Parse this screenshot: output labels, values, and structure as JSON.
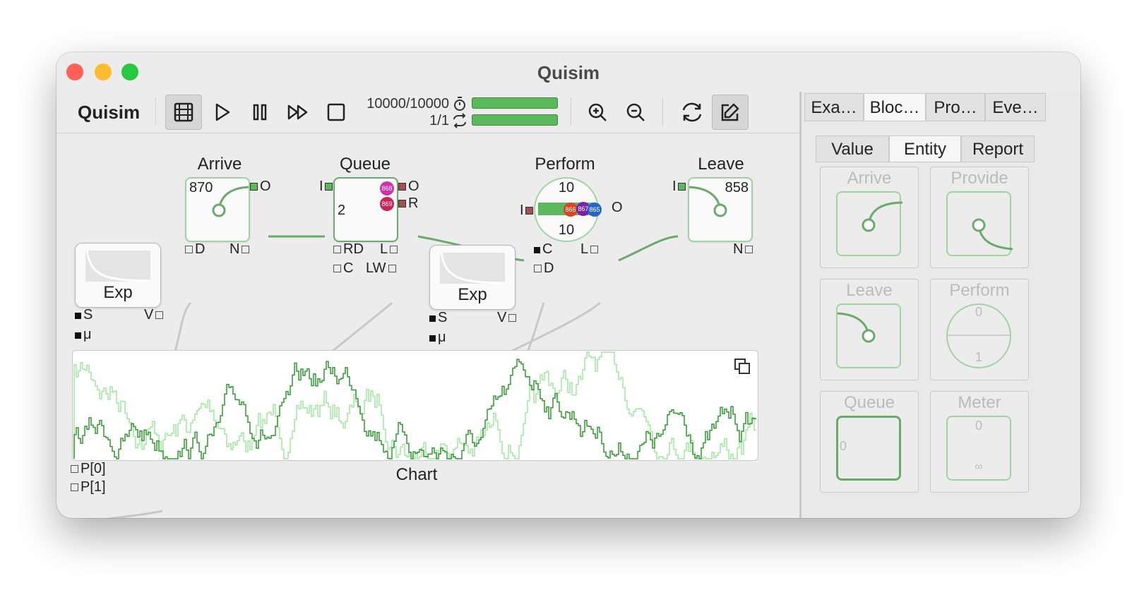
{
  "window": {
    "title": "Quisim"
  },
  "toolbar": {
    "app_name": "Quisim",
    "buttons": [
      "film-icon",
      "play-icon",
      "pause-icon",
      "fast-forward-icon",
      "stop-icon",
      "zoom-in-icon",
      "zoom-out-icon",
      "reset-icon",
      "edit-icon"
    ],
    "counter_time": "10000/10000",
    "counter_runs": "1/1",
    "progress_time": 1.0,
    "progress_runs": 1.0
  },
  "canvas": {
    "arrive": {
      "label": "Arrive",
      "count": "870",
      "out_port": "O",
      "d_port": "D",
      "n_port": "N"
    },
    "queue": {
      "label": "Queue",
      "in_port": "I",
      "count": "2",
      "badge_1": "868",
      "badge_2": "869",
      "out_port": "O",
      "r_port": "R",
      "rd_port": "RD",
      "l_port": "L",
      "c_port": "C",
      "lw_port": "LW"
    },
    "perform": {
      "label": "Perform",
      "top_value": "10",
      "bottom_value": "10",
      "in_port": "I",
      "c_port": "C",
      "l_port": "L",
      "d_port": "D",
      "out_port": "O",
      "entities": [
        "866",
        "867",
        "865"
      ]
    },
    "leave": {
      "label": "Leave",
      "count": "858",
      "in_port": "I",
      "n_port": "N"
    },
    "exp1": {
      "label": "Exp",
      "s_port": "S",
      "v_port": "V",
      "mu_port": "μ"
    },
    "exp2": {
      "label": "Exp",
      "s_port": "S",
      "v_port": "V",
      "mu_port": "μ"
    },
    "chart": {
      "label": "Chart",
      "p0": "P[0]",
      "p1": "P[1]"
    }
  },
  "sidebar": {
    "top_tabs": [
      "Exa…",
      "Bloc…",
      "Pro…",
      "Eve…"
    ],
    "sub_tabs": [
      "Value",
      "Entity",
      "Report"
    ],
    "palette": [
      {
        "label": "Arrive"
      },
      {
        "label": "Provide"
      },
      {
        "label": "Leave"
      },
      {
        "label": "Perform",
        "top": "0",
        "bottom": "1"
      },
      {
        "label": "Queue",
        "value": "0"
      },
      {
        "label": "Meter",
        "top": "0",
        "bottom": "∞"
      }
    ]
  },
  "colors": {
    "accent_green": "#5cb85c",
    "light_green": "#9fd49f",
    "close": "#fe5f57",
    "minimize": "#febc2e",
    "zoom": "#28c840"
  }
}
